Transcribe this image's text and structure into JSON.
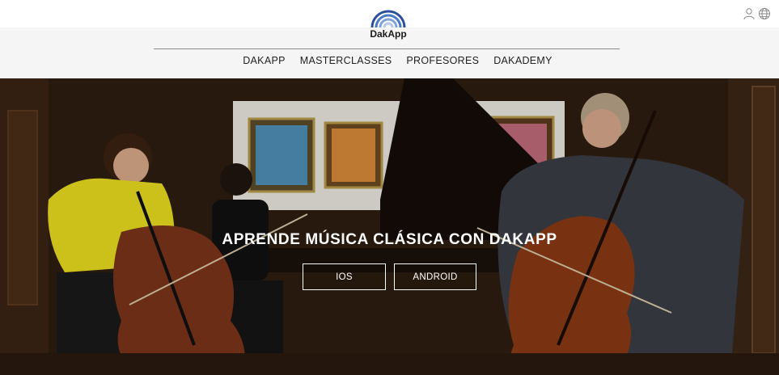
{
  "brand": {
    "name": "DakApp",
    "logo_colors": [
      "#2b4f9b",
      "#4a7ac6",
      "#7fa3d8",
      "#b5c8e8"
    ]
  },
  "account": {
    "user_icon": "user-icon",
    "language_icon": "globe-icon"
  },
  "nav": {
    "items": [
      {
        "label": "DAKAPP"
      },
      {
        "label": "MASTERCLASSES"
      },
      {
        "label": "PROFESORES"
      },
      {
        "label": "DAKADEMY"
      }
    ]
  },
  "hero": {
    "title": "APRENDE MÚSICA CLÁSICA CON DAKAPP",
    "buttons": [
      {
        "label": "IOS"
      },
      {
        "label": "ANDROID"
      }
    ]
  }
}
